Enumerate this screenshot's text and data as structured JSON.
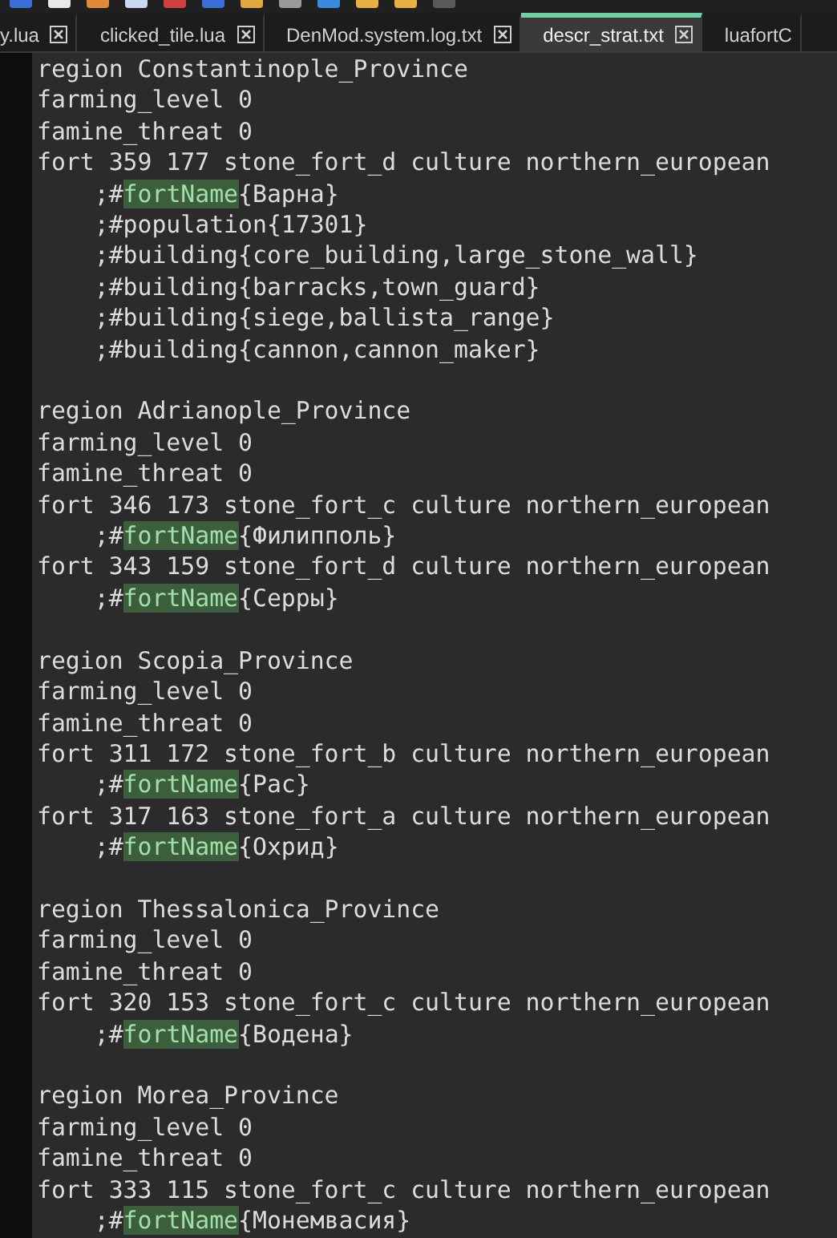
{
  "tabs": [
    {
      "label": "y.lua",
      "selected": false,
      "closable": true
    },
    {
      "label": "clicked_tile.lua",
      "selected": false,
      "closable": true
    },
    {
      "label": "DenMod.system.log.txt",
      "selected": false,
      "closable": true
    },
    {
      "label": "descr_strat.txt",
      "selected": true,
      "closable": true
    },
    {
      "label": "luafortC",
      "selected": false,
      "closable": false
    }
  ],
  "editor": {
    "blocks": [
      {
        "lines": [
          [
            {
              "text": "region Constantinople_Province"
            }
          ],
          [
            {
              "text": "farming_level 0"
            }
          ],
          [
            {
              "text": "famine_threat 0"
            }
          ],
          [
            {
              "text": "fort 359 177 stone_fort_d culture northern_european"
            }
          ],
          [
            {
              "text": "    ;#"
            },
            {
              "text": "fortName",
              "highlighted": true
            },
            {
              "text": "{Варна}"
            }
          ],
          [
            {
              "text": "    ;#population{17301}"
            }
          ],
          [
            {
              "text": "    ;#building{core_building,large_stone_wall}"
            }
          ],
          [
            {
              "text": "    ;#building{barracks,town_guard}"
            }
          ],
          [
            {
              "text": "    ;#building{siege,ballista_range}"
            }
          ],
          [
            {
              "text": "    ;#building{cannon,cannon_maker}"
            }
          ]
        ]
      },
      {
        "lines": [
          [
            {
              "text": "region Adrianople_Province"
            }
          ],
          [
            {
              "text": "farming_level 0"
            }
          ],
          [
            {
              "text": "famine_threat 0"
            }
          ],
          [
            {
              "text": "fort 346 173 stone_fort_c culture northern_european"
            }
          ],
          [
            {
              "text": "    ;#"
            },
            {
              "text": "fortName",
              "highlighted": true
            },
            {
              "text": "{Филипполь}"
            }
          ],
          [
            {
              "text": "fort 343 159 stone_fort_d culture northern_european"
            }
          ],
          [
            {
              "text": "    ;#"
            },
            {
              "text": "fortName",
              "highlighted": true
            },
            {
              "text": "{Серры}"
            }
          ]
        ]
      },
      {
        "lines": [
          [
            {
              "text": "region Scopia_Province"
            }
          ],
          [
            {
              "text": "farming_level 0"
            }
          ],
          [
            {
              "text": "famine_threat 0"
            }
          ],
          [
            {
              "text": "fort 311 172 stone_fort_b culture northern_european"
            }
          ],
          [
            {
              "text": "    ;#"
            },
            {
              "text": "fortName",
              "highlighted": true
            },
            {
              "text": "{Рас}"
            }
          ],
          [
            {
              "text": "fort 317 163 stone_fort_a culture northern_european"
            }
          ],
          [
            {
              "text": "    ;#"
            },
            {
              "text": "fortName",
              "highlighted": true
            },
            {
              "text": "{Охрид}"
            }
          ]
        ]
      },
      {
        "lines": [
          [
            {
              "text": "region Thessalonica_Province"
            }
          ],
          [
            {
              "text": "farming_level 0"
            }
          ],
          [
            {
              "text": "famine_threat 0"
            }
          ],
          [
            {
              "text": "fort 320 153 stone_fort_c culture northern_european"
            }
          ],
          [
            {
              "text": "    ;#"
            },
            {
              "text": "fortName",
              "highlighted": true
            },
            {
              "text": "{Водена}"
            }
          ]
        ]
      },
      {
        "lines": [
          [
            {
              "text": "region Morea_Province"
            }
          ],
          [
            {
              "text": "farming_level 0"
            }
          ],
          [
            {
              "text": "famine_threat 0"
            }
          ],
          [
            {
              "text": "fort 333 115 stone_fort_c culture northern_european"
            }
          ],
          [
            {
              "text": "    ;#"
            },
            {
              "text": "fortName",
              "highlighted": true
            },
            {
              "text": "{Монемвасия}"
            }
          ]
        ]
      }
    ]
  }
}
